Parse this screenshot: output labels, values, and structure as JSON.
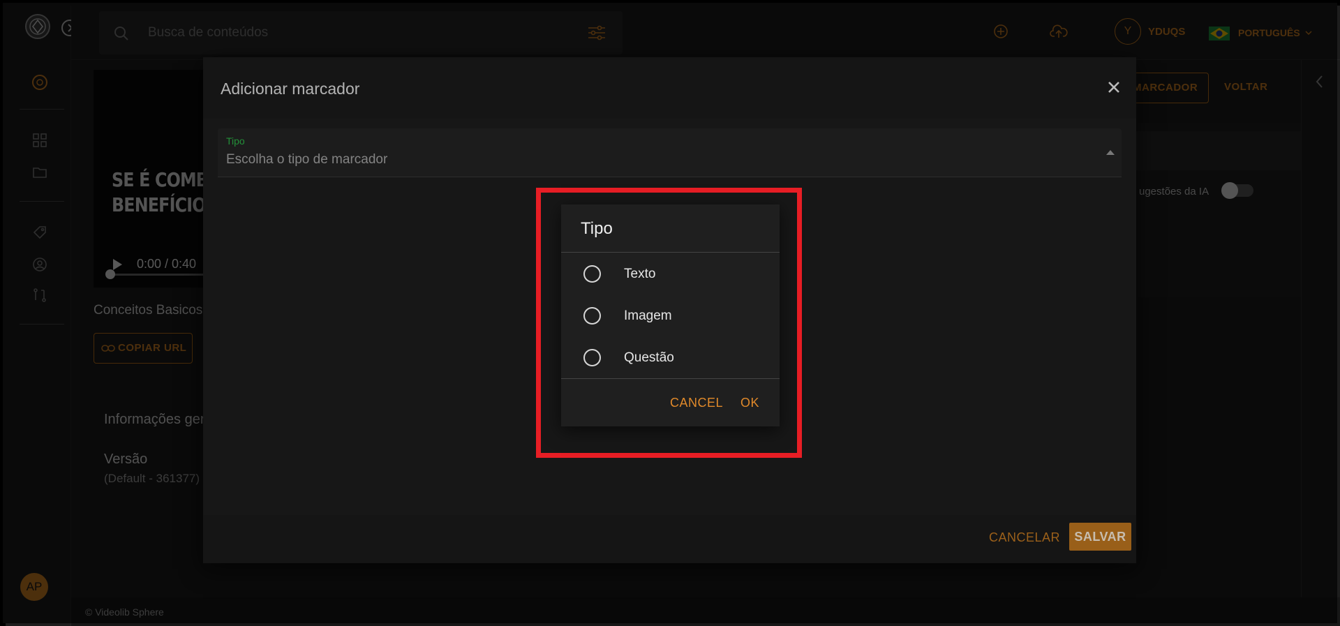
{
  "topbar": {
    "search_placeholder": "Busca de conteúdos",
    "user_initial": "Y",
    "user_name": "YDUQS",
    "language": "PORTUGUÊS"
  },
  "sidebar": {
    "avatar_initials": "AP"
  },
  "content": {
    "video_title": "SE É COMBO,\nBENEFÍCIO...",
    "video_time": "0:00 / 0:40",
    "video_name": "Conceitos Basicos",
    "copy_url_label": "COPIAR URL",
    "general_info_label": "Informações ger",
    "version_label": "Versão",
    "version_value": "(Default - 361377)",
    "marker_button_label": "MARCADOR",
    "back_button_label": "VOLTAR",
    "ai_suggestions_label": "ugestões da IA"
  },
  "footer": {
    "text": "© Videolib Sphere"
  },
  "dialog": {
    "title": "Adicionar marcador",
    "select_label": "Tipo",
    "select_value": "Escolha o tipo de marcador",
    "cancel_label": "CANCELAR",
    "save_label": "SALVAR"
  },
  "picker": {
    "title": "Tipo",
    "options": [
      {
        "label": "Texto"
      },
      {
        "label": "Imagem"
      },
      {
        "label": "Questão"
      }
    ],
    "cancel_label": "CANCEL",
    "ok_label": "OK"
  },
  "colors": {
    "accent": "#c77b22",
    "label_green": "#2eb84a",
    "highlight_red": "#e81e25"
  }
}
